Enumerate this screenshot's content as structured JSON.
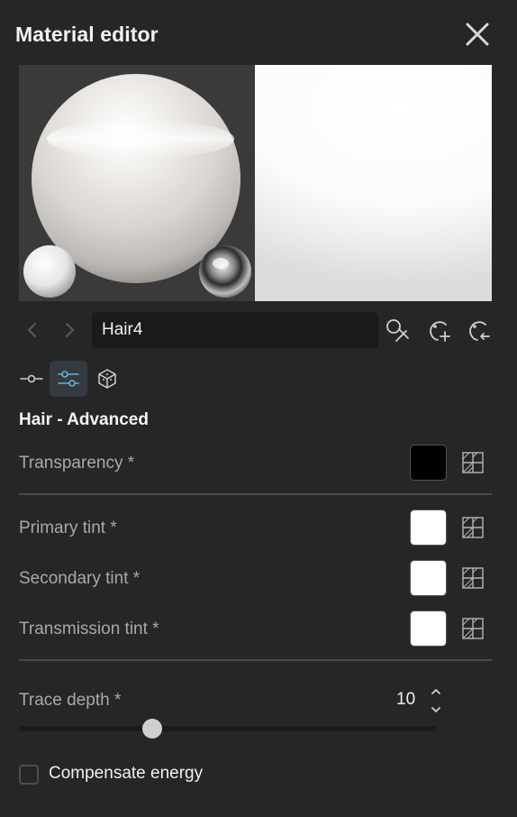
{
  "window": {
    "title": "Material editor",
    "close_icon": "close-icon"
  },
  "material": {
    "name": "Hair4"
  },
  "toolbar": {
    "prev_icon": "chevron-left-icon",
    "next_icon": "chevron-right-icon",
    "pick_icon": "eyedropper-icon",
    "new_icon": "add-material-icon",
    "reset_icon": "revert-material-icon"
  },
  "tabs": [
    {
      "name": "tab-nodes",
      "icon": "node-link-icon",
      "active": false
    },
    {
      "name": "tab-parameters",
      "icon": "sliders-icon",
      "active": true
    },
    {
      "name": "tab-3d",
      "icon": "cube-icon",
      "active": false
    }
  ],
  "section": {
    "title": "Hair - Advanced"
  },
  "properties": {
    "transparency": {
      "label": "Transparency *",
      "color": "#000000"
    },
    "primary_tint": {
      "label": "Primary tint *",
      "color": "#ffffff"
    },
    "secondary_tint": {
      "label": "Secondary tint *",
      "color": "#ffffff"
    },
    "transmission_tint": {
      "label": "Transmission tint *",
      "color": "#ffffff"
    },
    "trace_depth": {
      "label": "Trace depth *",
      "value": "10",
      "fraction": 0.32
    },
    "compensate_energy": {
      "label": "Compensate energy",
      "checked": false
    }
  },
  "colors": {
    "background": "#262626",
    "field": "#1a1a1a",
    "active_tab": "#343a3f",
    "accent": "#5fb7d6",
    "label": "#a9a9a9"
  }
}
